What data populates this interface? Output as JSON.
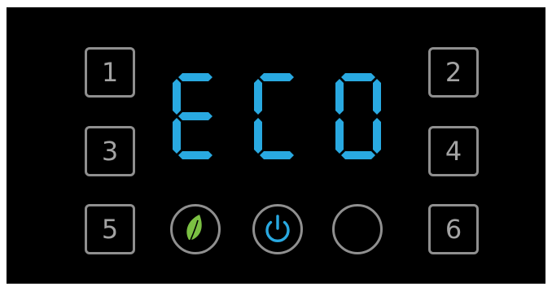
{
  "display": {
    "text": "ECO",
    "color": "#29a9e1",
    "digits": [
      {
        "char": "E",
        "segments": [
          "a",
          "d",
          "e",
          "f",
          "g"
        ]
      },
      {
        "char": "C",
        "segments": [
          "a",
          "d",
          "e",
          "f"
        ]
      },
      {
        "char": "0",
        "segments": [
          "a",
          "b",
          "c",
          "d",
          "e",
          "f"
        ]
      }
    ]
  },
  "keys": {
    "k1": "1",
    "k2": "2",
    "k3": "3",
    "k4": "4",
    "k5": "5",
    "k6": "6"
  },
  "buttons": {
    "eco": {
      "icon": "leaf-icon",
      "color": "#7bc043"
    },
    "power": {
      "icon": "power-icon",
      "color": "#29a9e1"
    },
    "blank": {
      "icon": ""
    }
  },
  "colors": {
    "background": "#000000",
    "outline": "#8f8f8f",
    "key_text": "#a3a3a3"
  }
}
